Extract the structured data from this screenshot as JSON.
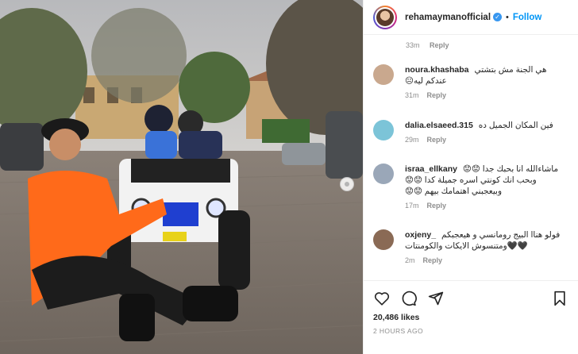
{
  "header": {
    "username": "rehamaymanofficial",
    "verified_mark": "✓",
    "separator": "•",
    "follow_label": "Follow"
  },
  "top_meta": {
    "time": "33m",
    "reply_label": "Reply"
  },
  "comments": [
    {
      "user": "noura.khashaba",
      "text": "هي الجنة مش بتشتي عندكم ليه😐",
      "time": "31m",
      "reply_label": "Reply",
      "avatar_color": "#c9a88e"
    },
    {
      "user": "dalia.elsaeed.315",
      "text": "فين المكان الجميل ده",
      "time": "29m",
      "reply_label": "Reply",
      "avatar_color": "#7cc4d8"
    },
    {
      "user": "israa_ellkany",
      "text": "ماشاءالله انا بحبك جدا 😟😟 وبحب انك كونتي اسره جميلة كدا 😟😟 وبيعجبني اهتمامك بيهم 😟😟",
      "time": "17m",
      "reply_label": "Reply",
      "avatar_color": "#9aa7b8"
    },
    {
      "user": "oxjeny_",
      "text": "فولو هناا البيج رومانسي و هيعجبكم 🖤🖤ومتنسوش الايكات والكومنتات",
      "time": "2m",
      "reply_label": "Reply",
      "avatar_color": "#8a6a55"
    }
  ],
  "actions": {
    "icons": [
      "heart-icon",
      "comment-icon",
      "share-icon",
      "bookmark-icon"
    ],
    "likes": "20,486 likes",
    "posted": "2 HOURS AGO"
  },
  "colors": {
    "accent": "#0095f6",
    "verified": "#3897f0",
    "muted": "#8e8e8e",
    "orange_sweater": "#ff6a1a"
  }
}
